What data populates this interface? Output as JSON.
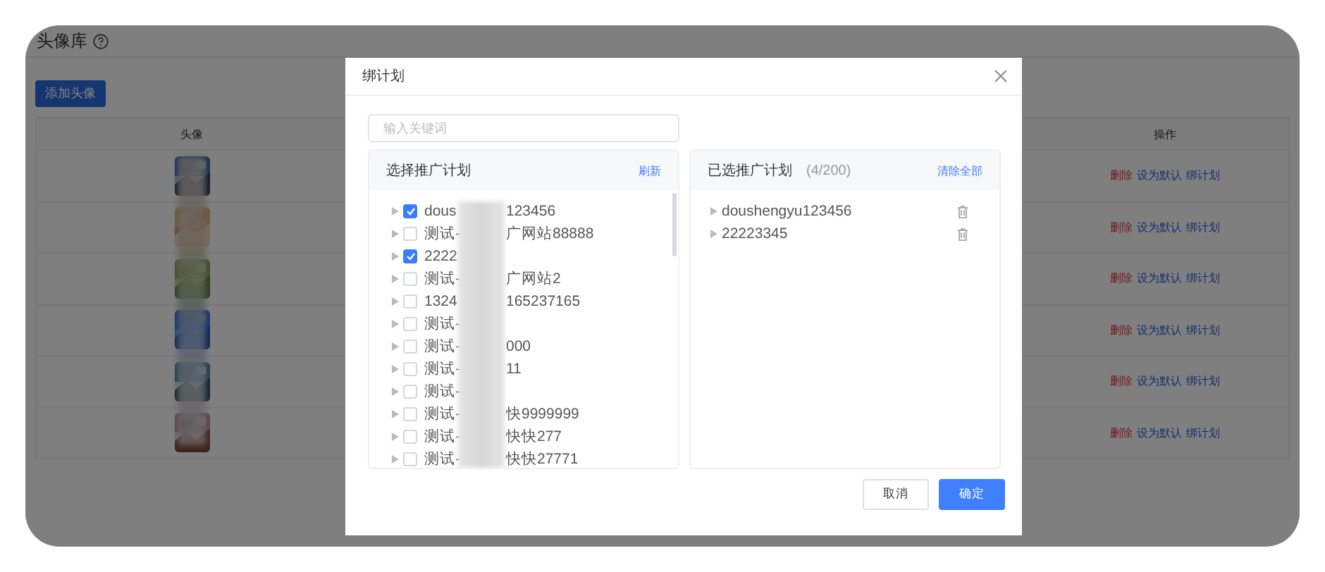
{
  "page": {
    "title": "头像库",
    "add_button": "添加头像",
    "table": {
      "columns": [
        "头像",
        "操作"
      ],
      "rows": [
        {
          "actions": [
            {
              "label": "删除",
              "kind": "danger"
            },
            {
              "label": "设为默认",
              "kind": "link"
            },
            {
              "label": "绑计划",
              "kind": "link"
            }
          ]
        },
        {
          "actions": [
            {
              "label": "删除",
              "kind": "danger"
            },
            {
              "label": "设为默认",
              "kind": "link"
            },
            {
              "label": "绑计划",
              "kind": "link"
            }
          ]
        },
        {
          "actions": [
            {
              "label": "删除",
              "kind": "danger"
            },
            {
              "label": "设为默认",
              "kind": "link"
            },
            {
              "label": "绑计划",
              "kind": "link"
            }
          ]
        },
        {
          "actions": [
            {
              "label": "删除",
              "kind": "danger"
            },
            {
              "label": "设为默认",
              "kind": "link"
            },
            {
              "label": "绑计划",
              "kind": "link"
            }
          ]
        },
        {
          "actions": [
            {
              "label": "删除",
              "kind": "danger"
            },
            {
              "label": "设为默认",
              "kind": "link"
            },
            {
              "label": "绑计划",
              "kind": "link"
            }
          ]
        },
        {
          "actions": [
            {
              "label": "删除",
              "kind": "danger"
            },
            {
              "label": "设为默认",
              "kind": "link"
            },
            {
              "label": "绑计划",
              "kind": "link"
            }
          ]
        }
      ]
    }
  },
  "dialog": {
    "title": "绑计划",
    "search": {
      "placeholder": "输入关键词"
    },
    "available": {
      "title": "选择推广计划",
      "action": "刷新",
      "items": [
        {
          "prefix": "dous",
          "suffix": "123456",
          "checked": true
        },
        {
          "prefix": "测试-",
          "suffix": "广网站88888",
          "checked": false
        },
        {
          "prefix": "2222",
          "checked": true
        },
        {
          "prefix": "测试-",
          "suffix": "广网站2",
          "checked": false
        },
        {
          "prefix": "1324",
          "suffix": "165237165",
          "checked": false
        },
        {
          "prefix": "测试-",
          "checked": false
        },
        {
          "prefix": "测试-",
          "suffix": "000",
          "checked": false
        },
        {
          "prefix": "测试-",
          "suffix": "11",
          "checked": false
        },
        {
          "prefix": "测试-",
          "checked": false
        },
        {
          "prefix": "测试-",
          "suffix": "快9999999",
          "checked": false
        },
        {
          "prefix": "测试-",
          "suffix": "快快277",
          "checked": false
        },
        {
          "prefix": "测试-",
          "suffix": "快快27771",
          "checked": false
        }
      ]
    },
    "selected": {
      "title": "已选推广计划",
      "count": "(4/200)",
      "action": "清除全部",
      "items": [
        "doushengyu123456",
        "22223345"
      ]
    },
    "buttons": [
      {
        "label": "取消",
        "kind": "secondary"
      },
      {
        "label": "确定",
        "kind": "primary"
      }
    ]
  }
}
